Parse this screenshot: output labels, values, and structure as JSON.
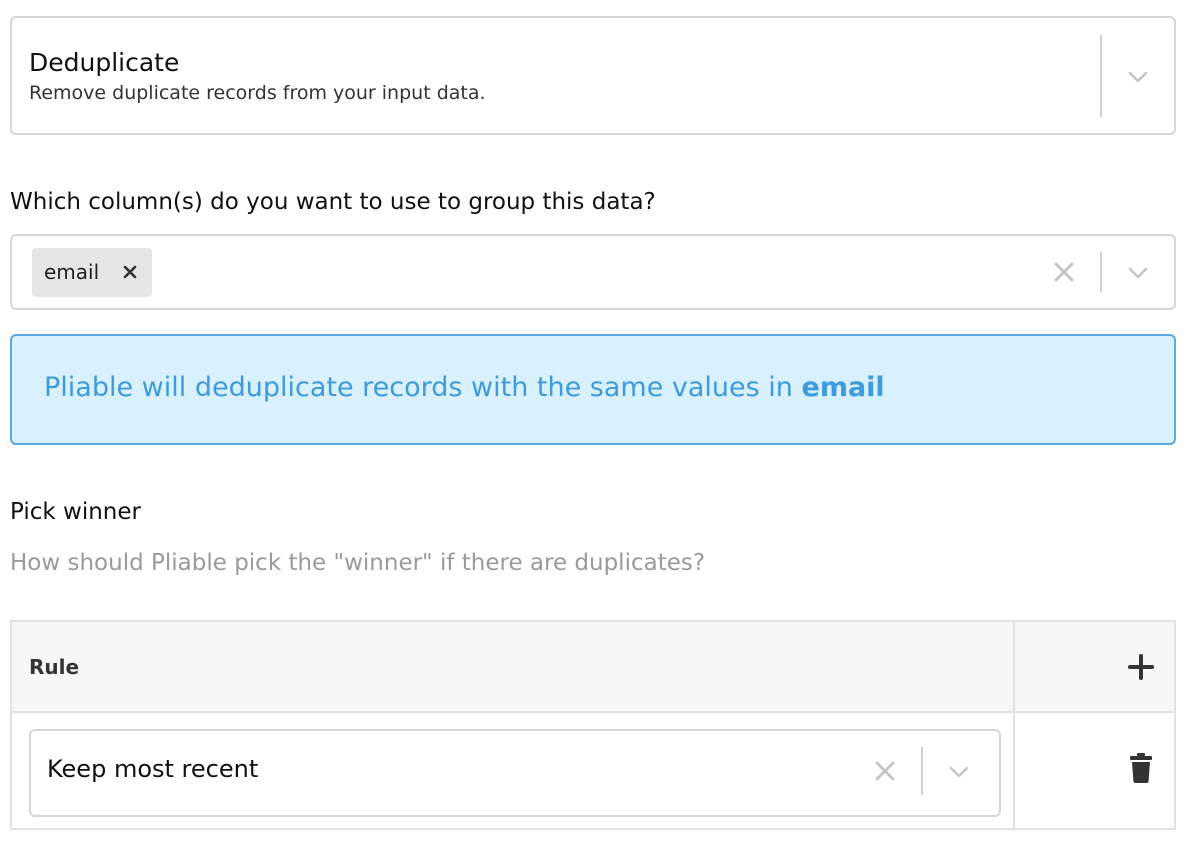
{
  "operation": {
    "title": "Deduplicate",
    "description": "Remove duplicate records from your input data."
  },
  "group_columns": {
    "label": "Which column(s) do you want to use to group this data?",
    "selected": [
      "email"
    ]
  },
  "info": {
    "text_prefix": "Pliable will deduplicate records with the same values in ",
    "column": "email"
  },
  "pick_winner": {
    "title": "Pick winner",
    "help": "How should Pliable pick the \"winner\" if there are duplicates?",
    "table": {
      "header_rule": "Rule",
      "rows": [
        {
          "rule": "Keep most recent"
        }
      ]
    }
  },
  "colors": {
    "info_bg": "#d9f1fd",
    "info_border": "#5aa9e0",
    "info_text": "#3d9bde"
  },
  "icons": {
    "dropdown": "chevron-down-icon",
    "clear": "close-icon",
    "add": "plus-icon",
    "delete": "trash-icon"
  }
}
